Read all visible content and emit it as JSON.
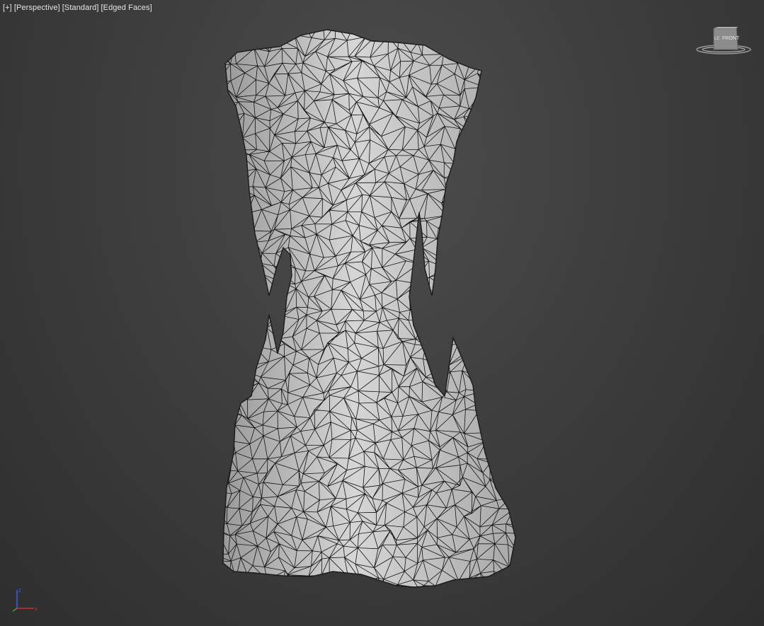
{
  "viewport": {
    "labels": {
      "plus": "[+]",
      "view": "[Perspective]",
      "shading": "[Standard]",
      "display_mode": "[Edged Faces]"
    },
    "viewcube": {
      "front_label": "FRONT",
      "left_label": "LE"
    },
    "axis": {
      "x": "x",
      "z": "z"
    }
  },
  "colors": {
    "background_center": "#4d4d4d",
    "background_edge": "#2e2e2e",
    "mesh_face": "#c9c9c9",
    "mesh_edge": "#111111",
    "axis_x": "#d03030",
    "axis_y": "#30b030",
    "axis_z": "#3a5fe0"
  },
  "icons": {
    "viewcube": "viewcube-icon",
    "axis": "axis-tripod-icon"
  }
}
